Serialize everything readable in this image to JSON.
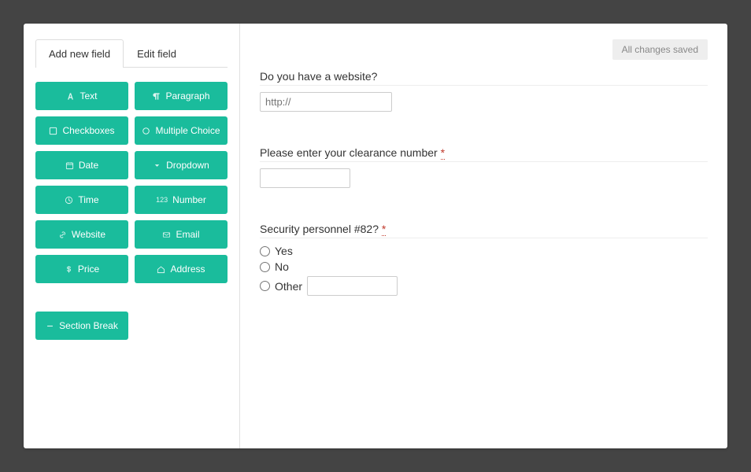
{
  "status": {
    "saved_label": "All changes saved"
  },
  "tabs": {
    "add_new": "Add new field",
    "edit": "Edit field"
  },
  "field_types": {
    "text": "Text",
    "paragraph": "Paragraph",
    "checkboxes": "Checkboxes",
    "multiple_choice": "Multiple Choice",
    "date": "Date",
    "dropdown": "Dropdown",
    "time": "Time",
    "number": "Number",
    "website": "Website",
    "email": "Email",
    "price": "Price",
    "address": "Address",
    "section_break": "Section Break"
  },
  "number_prefix": "123",
  "form": {
    "q1": {
      "label": "Do you have a website?",
      "placeholder": "http://"
    },
    "q2": {
      "label": "Please enter your clearance number",
      "required_mark": "*"
    },
    "q3": {
      "label": "Security personnel #82?",
      "required_mark": "*",
      "options": {
        "yes": "Yes",
        "no": "No",
        "other": "Other"
      }
    }
  }
}
